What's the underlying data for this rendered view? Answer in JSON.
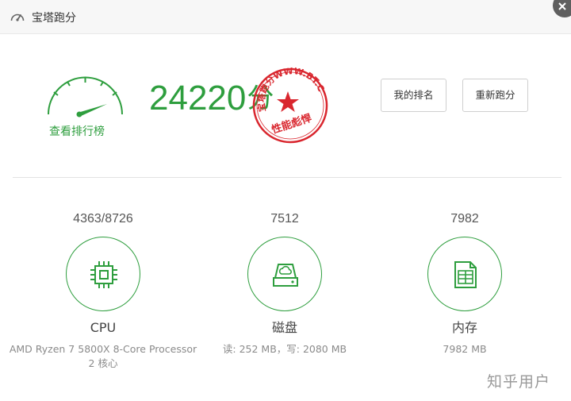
{
  "window": {
    "title": "宝塔跑分"
  },
  "summary": {
    "gauge_link": "查看排行榜",
    "score": "24220",
    "score_unit": "分",
    "stamp": {
      "ring_text": "宝塔跑分WWW.BT.CN",
      "bottom_text": "性能彪悍",
      "color": "#d9262e"
    }
  },
  "buttons": {
    "rank": "我的排名",
    "retest": "重新跑分"
  },
  "items": [
    {
      "score": "4363/8726",
      "icon": "cpu-icon",
      "name": "CPU",
      "desc": [
        "AMD Ryzen 7 5800X 8-Core Processor",
        "2 核心"
      ]
    },
    {
      "score": "7512",
      "icon": "disk-icon",
      "name": "磁盘",
      "desc": [
        "读: 252 MB，写: 2080 MB"
      ]
    },
    {
      "score": "7982",
      "icon": "memory-icon",
      "name": "内存",
      "desc": [
        "7982 MB"
      ]
    }
  ],
  "watermark": "知乎用户",
  "colors": {
    "accent": "#2e9e3e",
    "stamp": "#d9262e"
  }
}
